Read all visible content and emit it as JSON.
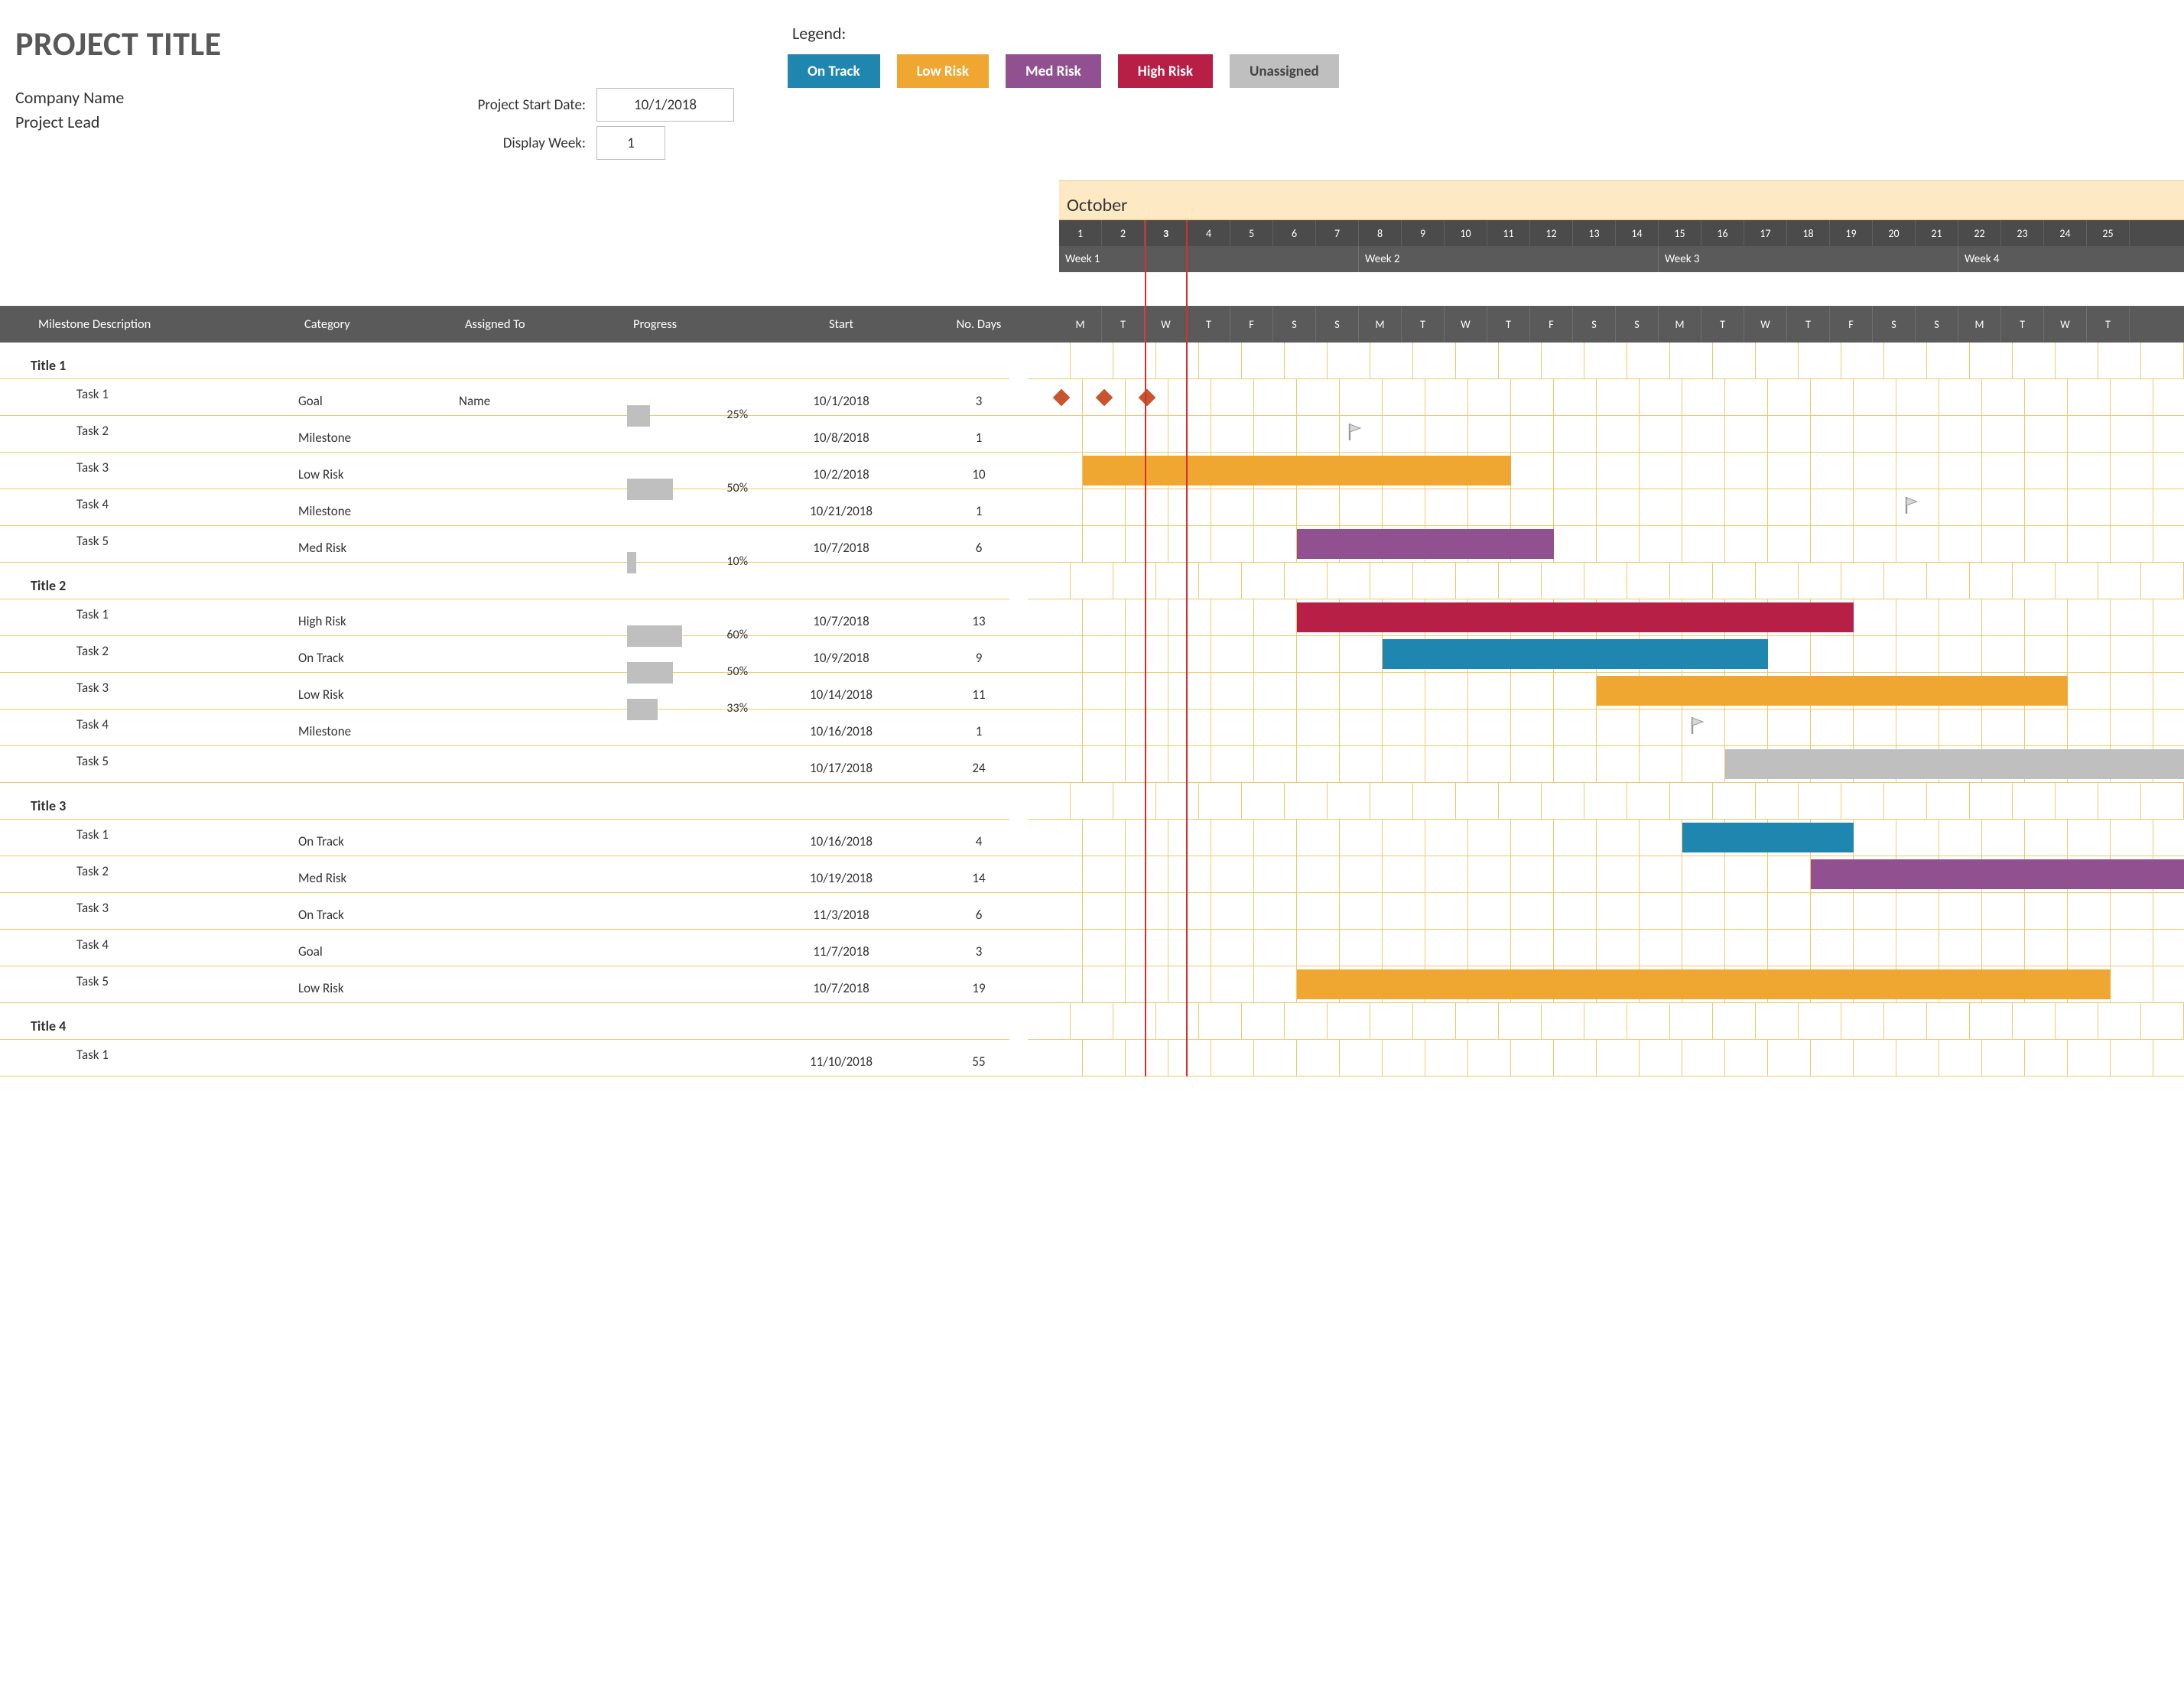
{
  "header": {
    "project_title": "PROJECT TITLE",
    "company_name": "Company Name",
    "project_lead": "Project Lead",
    "start_date_label": "Project Start Date:",
    "start_date": "10/1/2018",
    "display_week_label": "Display Week:",
    "display_week": "1",
    "legend_label": "Legend:",
    "legend": {
      "on_track": "On Track",
      "low_risk": "Low Risk",
      "med_risk": "Med Risk",
      "high_risk": "High Risk",
      "unassigned": "Unassigned"
    }
  },
  "columns": {
    "milestone": "Milestone Description",
    "category": "Category",
    "assigned": "Assigned To",
    "progress": "Progress",
    "start": "Start",
    "days": "No. Days"
  },
  "timeline": {
    "month": "October",
    "today_index": 2,
    "start_day": 1,
    "days": [
      {
        "num": "1",
        "dow": "M"
      },
      {
        "num": "2",
        "dow": "T"
      },
      {
        "num": "3",
        "dow": "W"
      },
      {
        "num": "4",
        "dow": "T"
      },
      {
        "num": "5",
        "dow": "F"
      },
      {
        "num": "6",
        "dow": "S"
      },
      {
        "num": "7",
        "dow": "S"
      },
      {
        "num": "8",
        "dow": "M"
      },
      {
        "num": "9",
        "dow": "T"
      },
      {
        "num": "10",
        "dow": "W"
      },
      {
        "num": "11",
        "dow": "T"
      },
      {
        "num": "12",
        "dow": "F"
      },
      {
        "num": "13",
        "dow": "S"
      },
      {
        "num": "14",
        "dow": "S"
      },
      {
        "num": "15",
        "dow": "M"
      },
      {
        "num": "16",
        "dow": "T"
      },
      {
        "num": "17",
        "dow": "W"
      },
      {
        "num": "18",
        "dow": "T"
      },
      {
        "num": "19",
        "dow": "F"
      },
      {
        "num": "20",
        "dow": "S"
      },
      {
        "num": "21",
        "dow": "S"
      },
      {
        "num": "22",
        "dow": "M"
      },
      {
        "num": "23",
        "dow": "T"
      },
      {
        "num": "24",
        "dow": "W"
      },
      {
        "num": "25",
        "dow": "T"
      }
    ],
    "weeks": [
      "Week 1",
      "Week 2",
      "Week 3",
      "Week 4"
    ]
  },
  "colors": {
    "On Track": "#1f86b0",
    "Low Risk": "#f0a732",
    "Med Risk": "#91508f",
    "High Risk": "#b71f46",
    "Unassigned": "#bfbfbf"
  },
  "chart_data": {
    "type": "gantt",
    "x_start": "10/1/2018",
    "x_unit": "days",
    "visible_days": 25,
    "today": "10/3/2018",
    "categories": [
      "Goal",
      "Milestone",
      "On Track",
      "Low Risk",
      "Med Risk",
      "High Risk",
      ""
    ],
    "sections": [
      {
        "title": "Title 1",
        "tasks": [
          {
            "name": "Task 1",
            "category": "Goal",
            "assigned": "Name",
            "progress": 25,
            "start": "10/1/2018",
            "days": 3,
            "start_idx": 0
          },
          {
            "name": "Task 2",
            "category": "Milestone",
            "assigned": "",
            "progress": null,
            "start": "10/8/2018",
            "days": 1,
            "start_idx": 7
          },
          {
            "name": "Task 3",
            "category": "Low Risk",
            "assigned": "",
            "progress": 50,
            "start": "10/2/2018",
            "days": 10,
            "start_idx": 1
          },
          {
            "name": "Task 4",
            "category": "Milestone",
            "assigned": "",
            "progress": null,
            "start": "10/21/2018",
            "days": 1,
            "start_idx": 20
          },
          {
            "name": "Task 5",
            "category": "Med Risk",
            "assigned": "",
            "progress": 10,
            "start": "10/7/2018",
            "days": 6,
            "start_idx": 6
          }
        ]
      },
      {
        "title": "Title 2",
        "tasks": [
          {
            "name": "Task 1",
            "category": "High Risk",
            "assigned": "",
            "progress": 60,
            "start": "10/7/2018",
            "days": 13,
            "start_idx": 6
          },
          {
            "name": "Task 2",
            "category": "On Track",
            "assigned": "",
            "progress": 50,
            "start": "10/9/2018",
            "days": 9,
            "start_idx": 8
          },
          {
            "name": "Task 3",
            "category": "Low Risk",
            "assigned": "",
            "progress": 33,
            "start": "10/14/2018",
            "days": 11,
            "start_idx": 13
          },
          {
            "name": "Task 4",
            "category": "Milestone",
            "assigned": "",
            "progress": null,
            "start": "10/16/2018",
            "days": 1,
            "start_idx": 15
          },
          {
            "name": "Task 5",
            "category": "",
            "assigned": "",
            "progress": null,
            "start": "10/17/2018",
            "days": 24,
            "start_idx": 16
          }
        ]
      },
      {
        "title": "Title 3",
        "tasks": [
          {
            "name": "Task 1",
            "category": "On Track",
            "assigned": "",
            "progress": null,
            "start": "10/16/2018",
            "days": 4,
            "start_idx": 15
          },
          {
            "name": "Task 2",
            "category": "Med Risk",
            "assigned": "",
            "progress": null,
            "start": "10/19/2018",
            "days": 14,
            "start_idx": 18
          },
          {
            "name": "Task 3",
            "category": "On Track",
            "assigned": "",
            "progress": null,
            "start": "11/3/2018",
            "days": 6,
            "start_idx": 33
          },
          {
            "name": "Task 4",
            "category": "Goal",
            "assigned": "",
            "progress": null,
            "start": "11/7/2018",
            "days": 3,
            "start_idx": 37
          },
          {
            "name": "Task 5",
            "category": "Low Risk",
            "assigned": "",
            "progress": null,
            "start": "10/7/2018",
            "days": 19,
            "start_idx": 6
          }
        ]
      },
      {
        "title": "Title 4",
        "tasks": [
          {
            "name": "Task 1",
            "category": "",
            "assigned": "",
            "progress": null,
            "start": "11/10/2018",
            "days": 55,
            "start_idx": 40
          }
        ]
      }
    ]
  }
}
